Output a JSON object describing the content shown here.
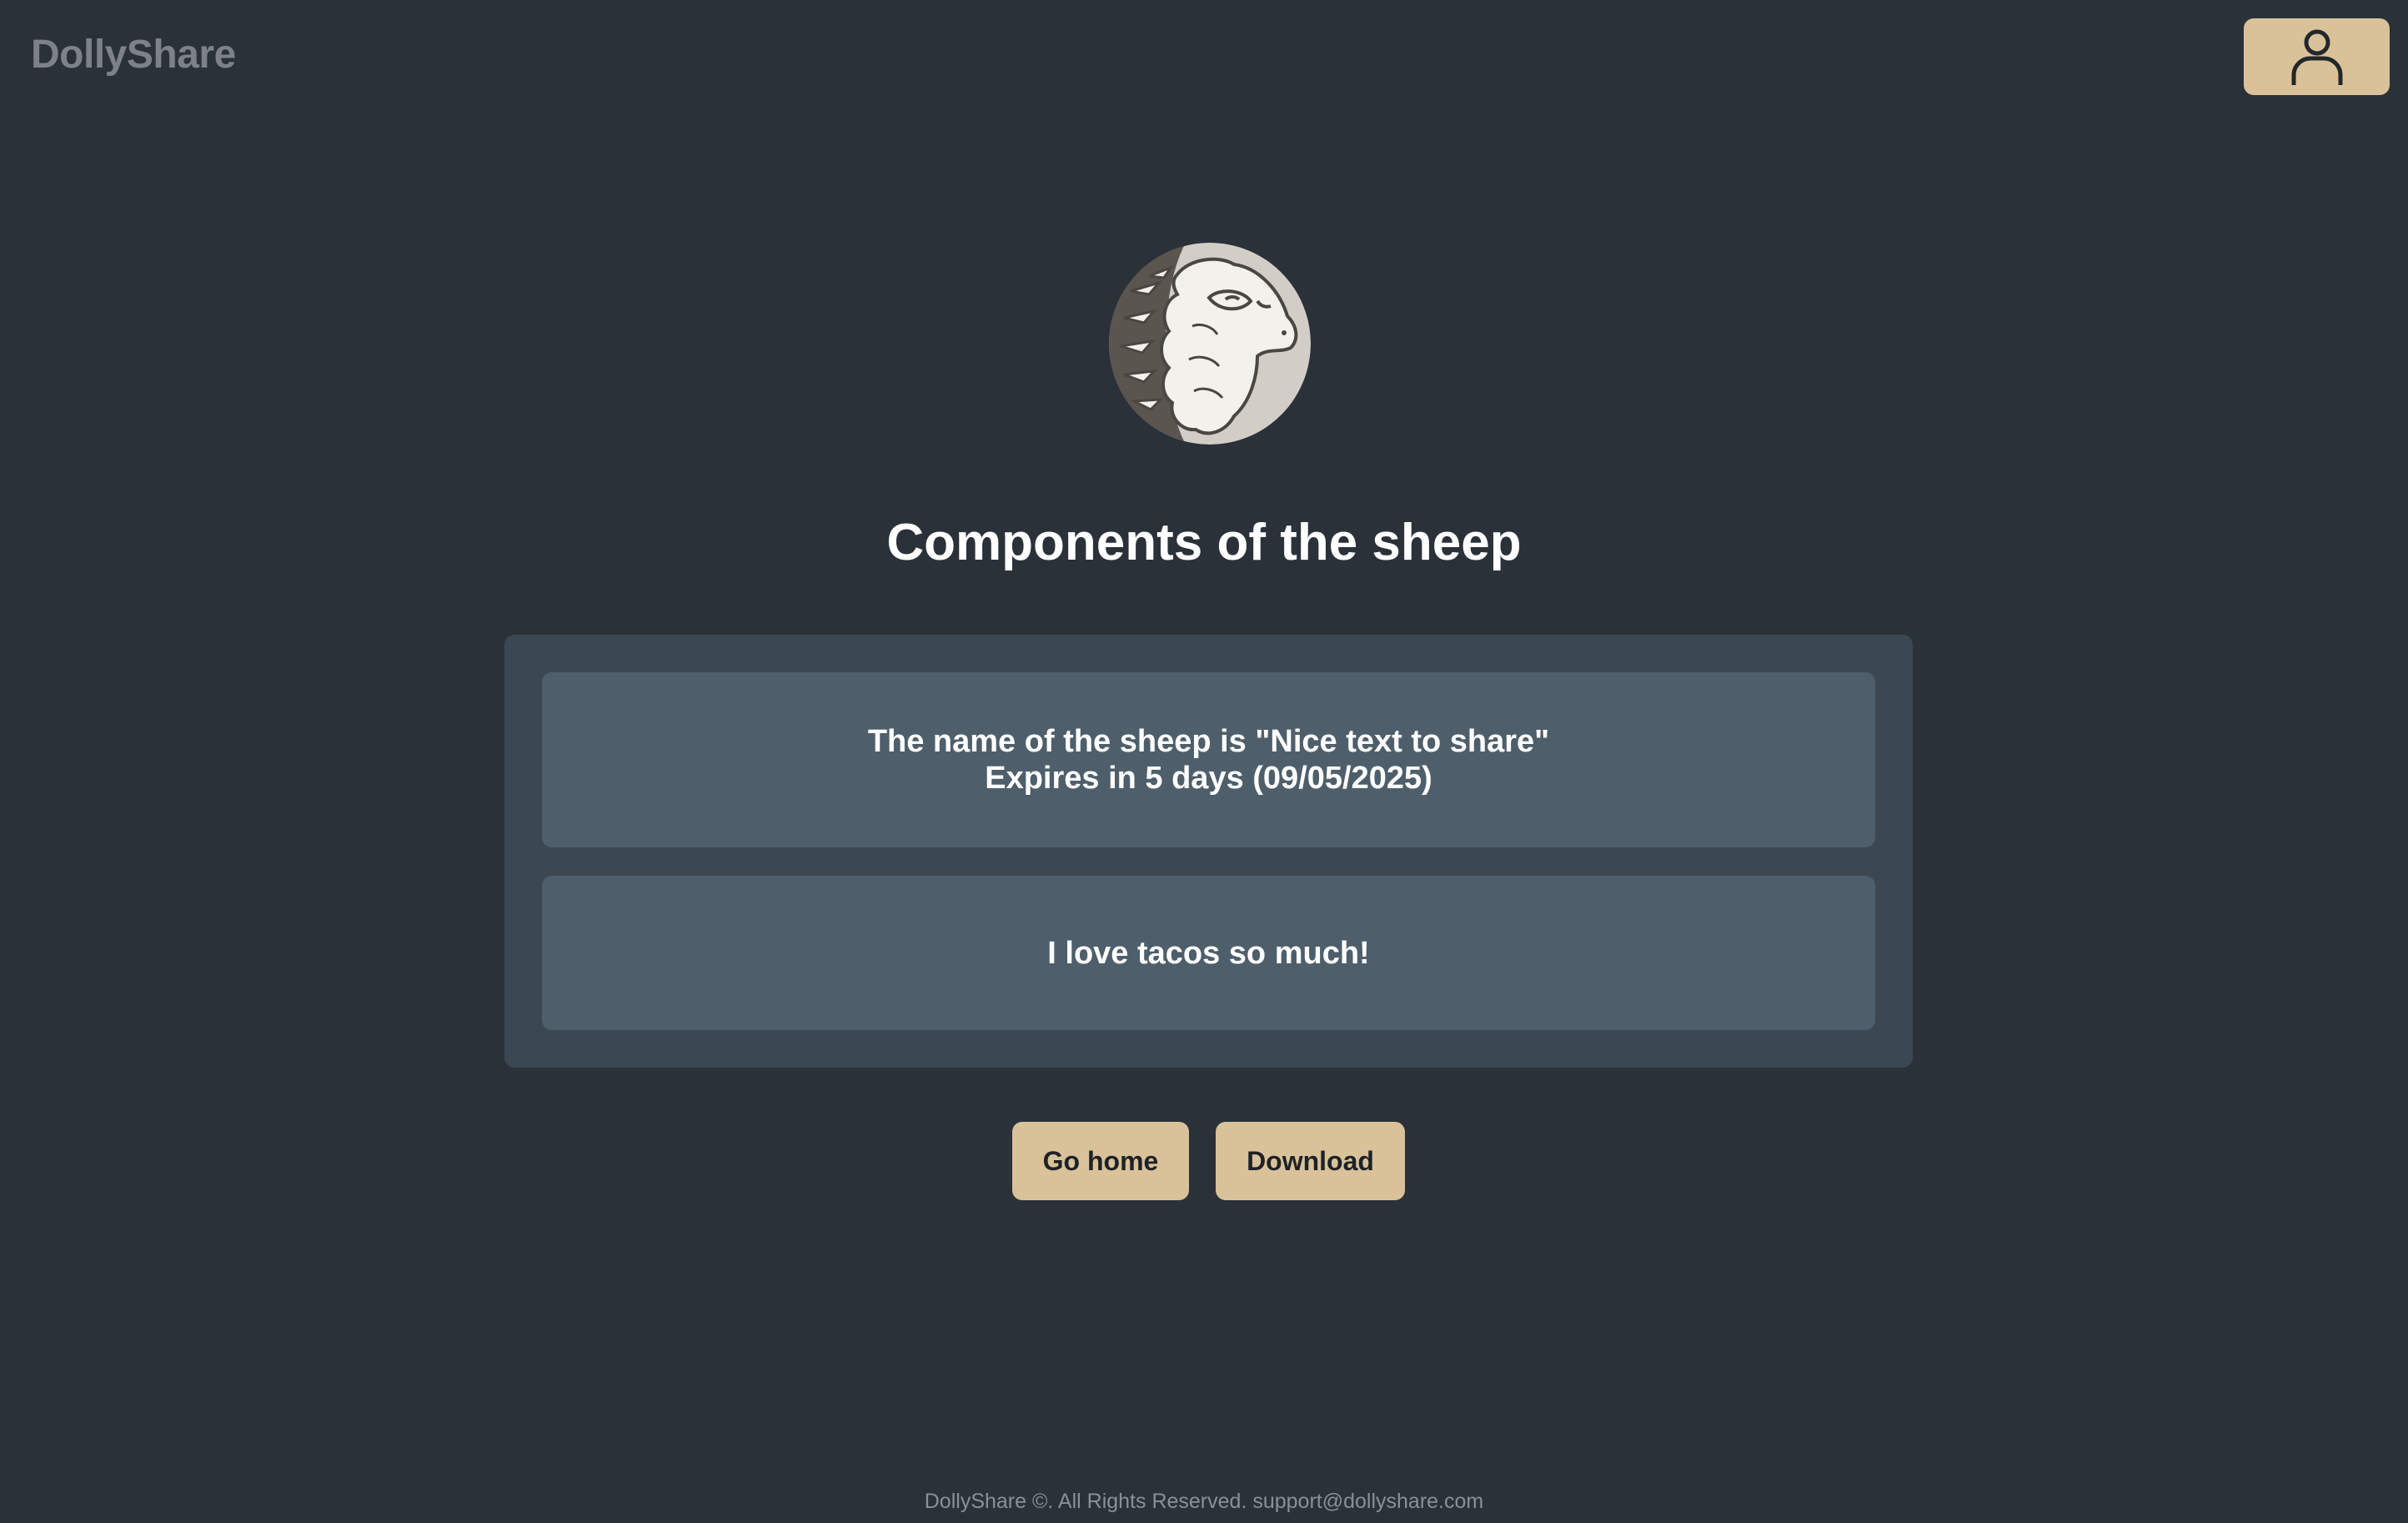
{
  "header": {
    "brand": "DollyShare",
    "user_icon": "user-icon"
  },
  "logo": {
    "icon": "sheep-logo-icon"
  },
  "main": {
    "title": "Components of the sheep",
    "info": {
      "name_line": "The name of the sheep is \"Nice text to share\"",
      "expires_line": "Expires in 5 days (09/05/2025)"
    },
    "content_text": "I love tacos so much!"
  },
  "actions": {
    "go_home_label": "Go home",
    "download_label": "Download"
  },
  "footer": {
    "text": "DollyShare ©. All Rights Reserved. support@dollyshare.com"
  },
  "colors": {
    "background": "#2a3139",
    "panel": "#3c4851",
    "card": "#4e5f6b",
    "accent": "#d9c299"
  }
}
